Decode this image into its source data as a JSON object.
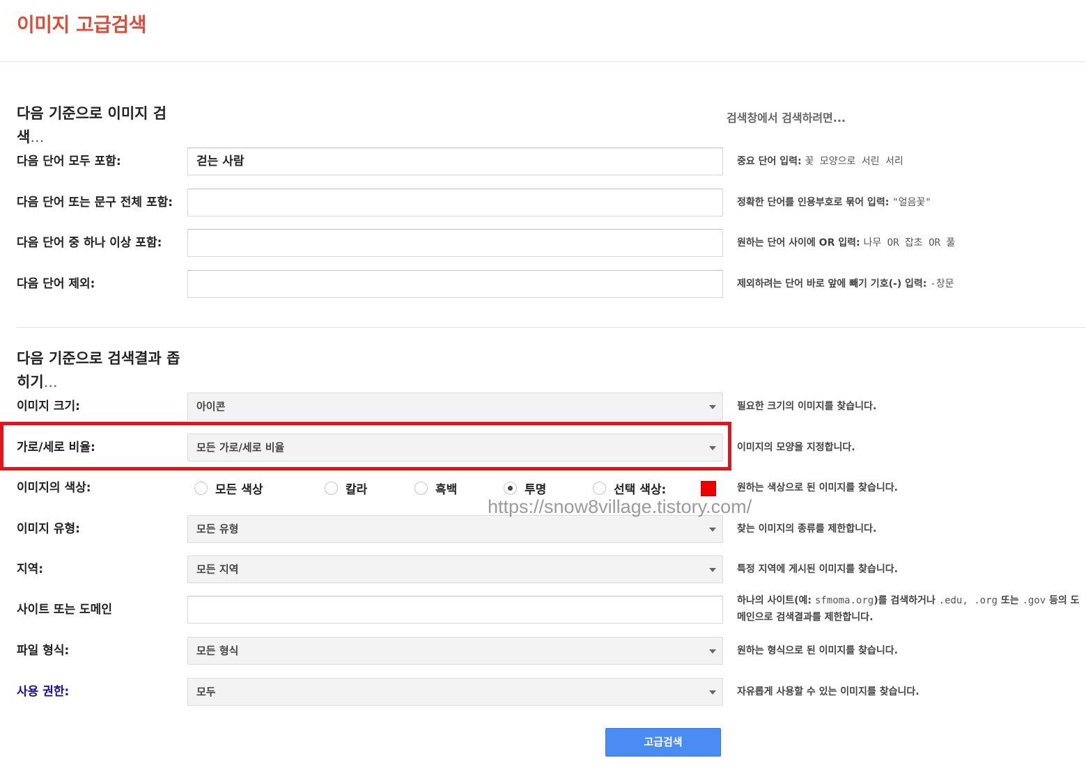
{
  "page": {
    "title": "이미지 고급검색"
  },
  "find": {
    "title_main": "다음 기준으로 이미지 검색",
    "title_dots": "...",
    "hint_header": "검색창에서 검색하려면...",
    "rows": [
      {
        "label": "다음 단어 모두 포함:",
        "value": "걷는 사람",
        "hint": "중요 단어 입력:",
        "example": "꽃 모양으로 서린 서리"
      },
      {
        "label": "다음 단어 또는 문구 전체 포함:",
        "value": "",
        "hint": "정확한 단어를 인용부호로 묶어 입력:",
        "example": "\"얼음꽃\""
      },
      {
        "label": "다음 단어 중 하나 이상 포함:",
        "value": "",
        "hint": "원하는 단어 사이에 OR 입력:",
        "example": "나무 OR 잡초 OR 풀"
      },
      {
        "label": "다음 단어 제외:",
        "value": "",
        "hint": "제외하려는 단어 바로 앞에 빼기 기호(-) 입력:",
        "example": "-창문"
      }
    ]
  },
  "narrow": {
    "title_main": "다음 기준으로 검색결과 좁히기",
    "title_dots": "...",
    "image_size": {
      "label": "이미지 크기:",
      "value": "아이콘",
      "hint": "필요한 크기의 이미지를 찾습니다."
    },
    "aspect_ratio": {
      "label": "가로/세로 비율:",
      "value": "모든 가로/세로 비율",
      "hint": "이미지의 모양을 지정합니다."
    },
    "color": {
      "label": "이미지의 색상:",
      "options": [
        "모든 색상",
        "칼라",
        "흑백",
        "투명",
        "선택 색상:"
      ],
      "selected": "투명",
      "swatch_color": "#ee0000",
      "hint": "원하는 색상으로 된 이미지를 찾습니다."
    },
    "image_type": {
      "label": "이미지 유형:",
      "value": "모든 유형",
      "hint": "찾는 이미지의 종류를 제한합니다."
    },
    "region": {
      "label": "지역:",
      "value": "모든 지역",
      "hint": "특정 지역에 게시된 이미지를 찾습니다."
    },
    "site": {
      "label": "사이트 또는 도메인",
      "value": "",
      "hint_a": "하나의 사이트(예:",
      "hint_ex1": "sfmoma.org",
      "hint_b": ")를 검색하거나",
      "hint_ex2": ".edu, .org",
      "hint_c": "또는",
      "hint_ex3": ".gov",
      "hint_d": "등의 도메인으로 검색결과를 제한합니다."
    },
    "file_type": {
      "label": "파일 형식:",
      "value": "모든 형식",
      "hint": "원하는 형식으로 된 이미지를 찾습니다."
    },
    "usage_rights": {
      "label": "사용 권한:",
      "value": "모두",
      "hint": "자유롭게 사용할 수 있는 이미지를 찾습니다."
    }
  },
  "watermark": "https://snow8village.tistory.com/",
  "submit_label": "고급검색",
  "colors": {
    "title": "#dd4b39",
    "highlight": "#e0151d",
    "button": "#4b8bf4",
    "link": "#1a0dab"
  }
}
